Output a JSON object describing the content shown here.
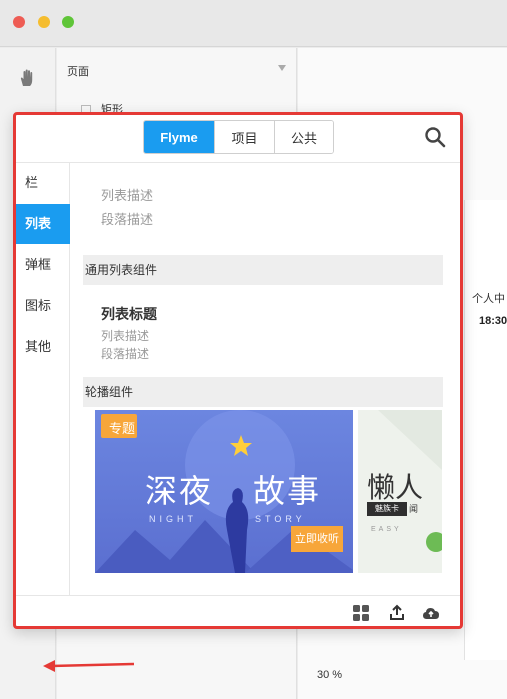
{
  "window": {
    "colors": {
      "close": "#ee5c54",
      "minimize": "#f5bd2f",
      "maximize": "#5fc538"
    }
  },
  "rail": {
    "tool_icon": "hand-icon",
    "more_label": "···"
  },
  "layers": {
    "header": "页面",
    "row_label": "矩形"
  },
  "canvas": {
    "label": "个人中",
    "time": "18:30",
    "zoom": "30 %"
  },
  "plugin": {
    "tabs": [
      "Flyme",
      "项目",
      "公共"
    ],
    "active_tab": "Flyme",
    "sidebar": [
      "栏",
      "列表",
      "弹框",
      "图标",
      "其他"
    ],
    "active_sidebar": "列表",
    "content": {
      "ghost_lines": [
        "列表描述",
        "段落描述"
      ],
      "section_1": "通用列表组件",
      "list_item": {
        "title": "列表标题",
        "desc": "列表描述",
        "para": "段落描述"
      },
      "section_2": "轮播组件",
      "banner1": {
        "tag": "专题",
        "headline_left": "深夜",
        "headline_right": "故事",
        "sub_left": "NIGHT",
        "sub_right": "STORY",
        "cta": "立即收听"
      },
      "banner2": {
        "headline": "懒人",
        "chip": "魅族卡",
        "chip_tail": "闻",
        "sub": "EASY"
      }
    },
    "footer_icons": [
      "grid-icon",
      "upload-icon",
      "cloud-upload-icon"
    ],
    "accent": "#1a9cf0",
    "highlight_border": "#e53935"
  }
}
